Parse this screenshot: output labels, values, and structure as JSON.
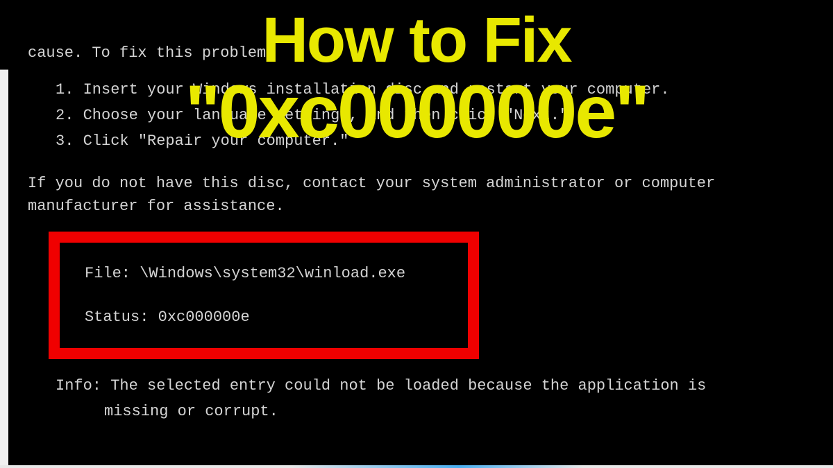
{
  "overlay": {
    "line1": "How to Fix",
    "line2": "\"0xc000000e\""
  },
  "error": {
    "cause_prefix": "cause. To fix this problem",
    "steps": {
      "one": "1. Insert your Windows installation disc and restart your computer.",
      "two": "2. Choose your language settings, and then click \"Next.\"",
      "three": "3. Click \"Repair your computer.\""
    },
    "no_disc": "If you do not have this disc, contact your system administrator or computer manufacturer for assistance.",
    "file_label": "File:",
    "file_value": "\\Windows\\system32\\winload.exe",
    "status_label": "Status:",
    "status_value": "0xc000000e",
    "info_label": "Info:",
    "info_text_line1": "The selected entry could not be loaded because the application is",
    "info_text_line2": "missing or corrupt."
  }
}
